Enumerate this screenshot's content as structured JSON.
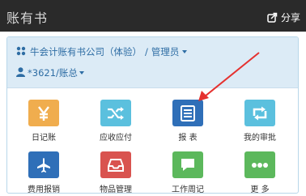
{
  "header": {
    "title": "账有书",
    "share_label": "分享"
  },
  "account": {
    "company": "牛会计账有书公司（体验）",
    "separator": "/",
    "role": "管理员",
    "book": "*3621/账总"
  },
  "menu": [
    {
      "label": "日记账",
      "icon": "yen-icon",
      "color": "#f0ad4e"
    },
    {
      "label": "应收应付",
      "icon": "shuffle-icon",
      "color": "#5bc0de"
    },
    {
      "label": "报 表",
      "icon": "report-icon",
      "color": "#2f6fb8"
    },
    {
      "label": "我的审批",
      "icon": "retweet-icon",
      "color": "#5bc0de"
    },
    {
      "label": "费用报销",
      "icon": "airplane-icon",
      "color": "#2f6fb8"
    },
    {
      "label": "物品管理",
      "icon": "inbox-icon",
      "color": "#d9534f"
    },
    {
      "label": "工作周记",
      "icon": "chat-icon",
      "color": "#5cb85c"
    },
    {
      "label": "更 多",
      "icon": "more-icon",
      "color": "#5cb85c"
    }
  ],
  "annotation": {
    "color": "#e5312f"
  }
}
